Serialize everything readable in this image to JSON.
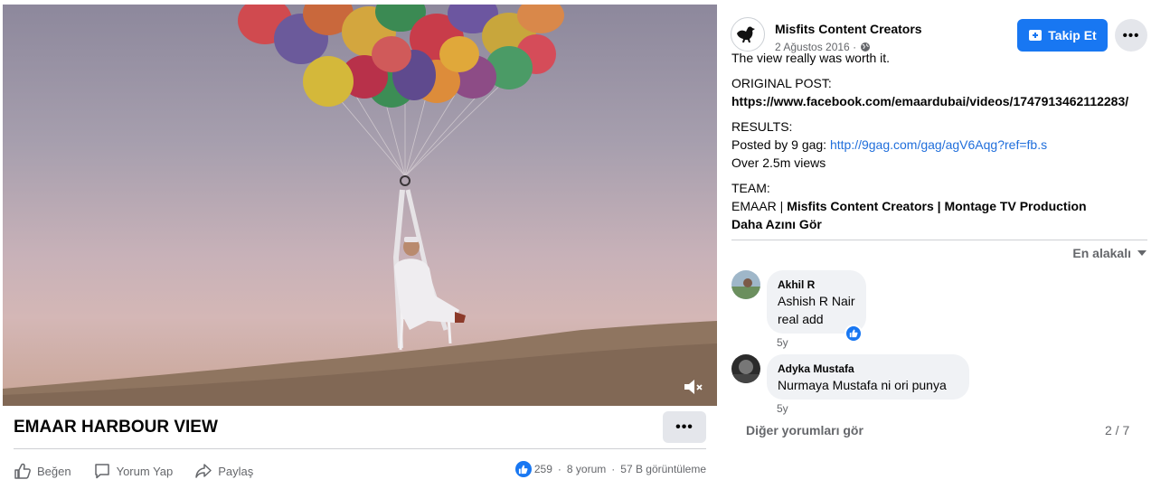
{
  "video": {
    "title": "EMAAR HARBOUR VIEW",
    "more_label": "•••",
    "mute_icon": "muted-speaker-icon"
  },
  "actions": {
    "like": "Beğen",
    "comment": "Yorum Yap",
    "share": "Paylaş"
  },
  "stats": {
    "likes": "259",
    "comments": "8 yorum",
    "views": "57 B görüntüleme"
  },
  "post": {
    "page_name": "Misfits Content Creators",
    "date": "2 Ağustos 2016 ·",
    "follow_label": "Takip Et",
    "more_label": "•••",
    "description": {
      "line1": "The view really was worth it.",
      "original_heading": "ORIGINAL POST:",
      "original_link": "https://www.facebook.com/emaardubai/videos/1747913462112283/",
      "results_heading": "RESULTS:",
      "posted_prefix": "Posted by 9 gag: ",
      "posted_link": "http://9gag.com/gag/agV6Aqg?ref=fb.s",
      "views_line": "Over 2.5m views",
      "team_heading": "TEAM:",
      "team_prefix": "EMAAR | ",
      "team_names": "Misfits Content Creators | Montage TV Production",
      "see_less": "Daha Azını Gör"
    }
  },
  "comments": {
    "sort_label": "En alakalı",
    "items": [
      {
        "author": "Akhil R",
        "line1": "Ashish R Nair",
        "line2": "real add",
        "time": "5y"
      },
      {
        "author": "Adyka Mustafa",
        "line1": "Nurmaya Mustafa ni ori punya",
        "time": "5y"
      }
    ],
    "more_label": "Diğer yorumları gör",
    "pager": "2 / 7"
  },
  "colors": {
    "accent": "#1877f2",
    "link": "#216fdb",
    "muted_text": "#65676b",
    "bubble": "#f0f2f5"
  }
}
